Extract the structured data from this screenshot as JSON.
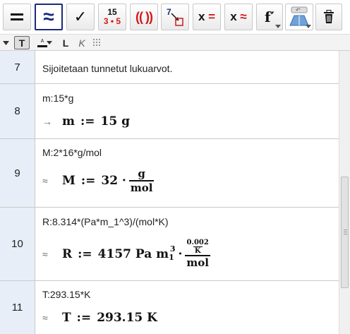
{
  "toolbar": {
    "tools": [
      {
        "name": "evaluate-tool",
        "glyph": "="
      },
      {
        "name": "numeric-tool",
        "glyph": "≈",
        "selected": true
      },
      {
        "name": "keep-input-tool",
        "glyph": "✓"
      },
      {
        "name": "factor-tool",
        "top": "15",
        "bottom": "3 • 5"
      },
      {
        "name": "expand-tool",
        "glyph": "(( ))"
      },
      {
        "name": "substitute-tool",
        "glyph": "7"
      },
      {
        "name": "solve-tool",
        "glyph": "x ="
      },
      {
        "name": "solve-numerically-tool",
        "glyph": "x ≈"
      },
      {
        "name": "derivative-tool",
        "glyph": "f′"
      },
      {
        "name": "undo-dropdown-tool",
        "glyph": "↶"
      },
      {
        "name": "delete-tool",
        "glyph": "trash"
      }
    ]
  },
  "stylebar": {
    "text_style": "T",
    "color_label": "A",
    "bold": "L",
    "italic": "K"
  },
  "rows": [
    {
      "num": "7",
      "input": "Sijoitetaan tunnetut lukuarvot."
    },
    {
      "num": "8",
      "input": "m:15*g",
      "prefix": "→",
      "lhs": "m",
      "assign": ":=",
      "rhs": "15 g"
    },
    {
      "num": "9",
      "input": "M:2*16*g/mol",
      "prefix": "≈",
      "lhs": "M",
      "assign": ":=",
      "rhs": "32 ·",
      "frac_num": "g",
      "frac_den": "mol"
    },
    {
      "num": "10",
      "input": "R:8.314*(Pa*m_1^3)/(mol*K)",
      "prefix": "≈",
      "lhs": "R",
      "assign": ":=",
      "rhs": "4157 Pa m",
      "sub": "1",
      "sup": "3",
      "dot": "·",
      "small_num": "0.002",
      "small_den": "K",
      "frac_den": "mol"
    },
    {
      "num": "11",
      "input": "T:293.15*K",
      "prefix": "≈",
      "lhs": "T",
      "assign": ":=",
      "rhs": "293.15 K"
    }
  ],
  "colors": {
    "accent": "#1b2a7a",
    "red": "#d11a1a",
    "rownum_bg": "#e8eef7"
  }
}
